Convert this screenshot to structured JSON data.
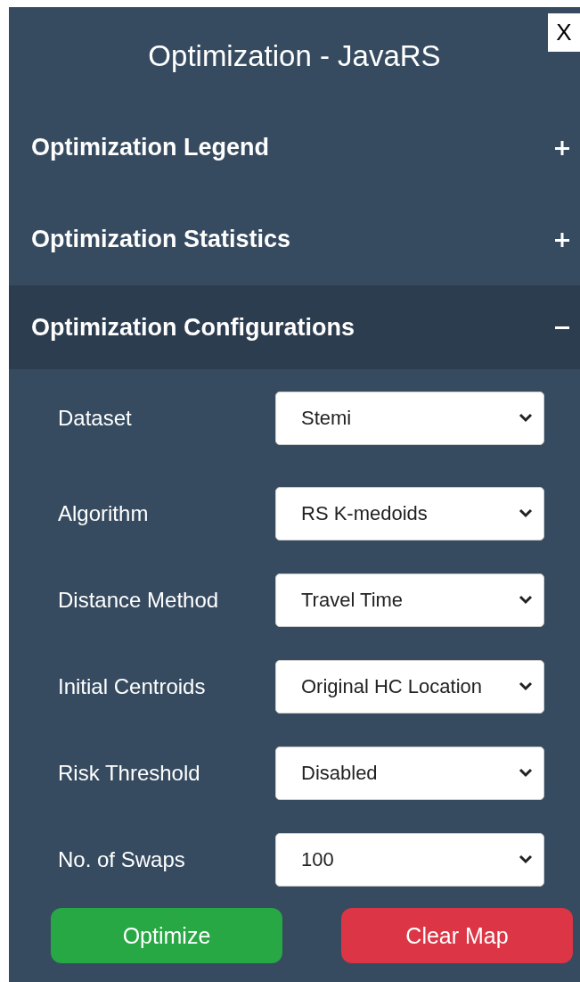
{
  "close_button": {
    "label": "X"
  },
  "title": "Optimization - JavaRS",
  "sections": [
    {
      "title": "Optimization Legend",
      "expanded": false
    },
    {
      "title": "Optimization Statistics",
      "expanded": false
    },
    {
      "title": "Optimization Configurations",
      "expanded": true,
      "fields": [
        {
          "label": "Dataset",
          "value": "Stemi"
        },
        {
          "label": "Algorithm",
          "value": "RS K-medoids"
        },
        {
          "label": "Distance Method",
          "value": "Travel Time"
        },
        {
          "label": "Initial Centroids",
          "value": "Original HC Location"
        },
        {
          "label": "Risk Threshold",
          "value": "Disabled"
        },
        {
          "label": "No. of Swaps",
          "value": "100"
        }
      ],
      "buttons": [
        {
          "label": "Optimize",
          "kind": "primary"
        },
        {
          "label": "Clear Map",
          "kind": "danger"
        }
      ]
    }
  ]
}
